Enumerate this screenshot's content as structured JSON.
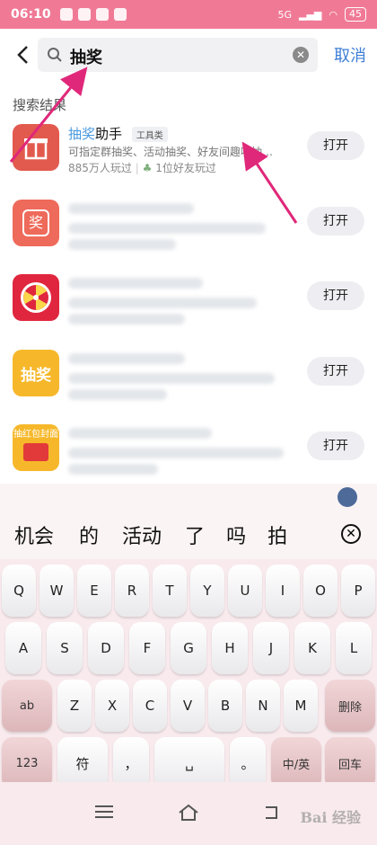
{
  "status_bar": {
    "time": "06:10",
    "network": "5G",
    "battery": "45"
  },
  "search": {
    "query": "抽奖",
    "cancel_label": "取消"
  },
  "results": {
    "section_title": "搜索结果",
    "first": {
      "title_highlight": "抽奖",
      "title_rest": "助手",
      "tag": "工具类",
      "description": "可指定群抽奖、活动抽奖、好友间趣味抽…",
      "players": "885万人玩过",
      "friends": "1位好友玩过"
    },
    "open_label": "打开",
    "icon_labels": [
      "奖",
      "抽奖",
      "抽红包封面"
    ]
  },
  "keyboard": {
    "candidates": [
      "机会",
      "的",
      "活动",
      "了",
      "吗",
      "拍"
    ],
    "row1": [
      "Q",
      "W",
      "E",
      "R",
      "T",
      "Y",
      "U",
      "I",
      "O",
      "P"
    ],
    "row2": [
      "A",
      "S",
      "D",
      "F",
      "G",
      "H",
      "J",
      "K",
      "L"
    ],
    "row3": [
      "Z",
      "X",
      "C",
      "V",
      "B",
      "N",
      "M"
    ],
    "shift_label": "ab",
    "delete_label": "删除",
    "num_label": "123",
    "symbol_label": "符",
    "comma_label": "，",
    "period_label": "。",
    "lang_label": "中/英",
    "enter_label": "回车"
  },
  "watermark": "Bai 经验",
  "colors": {
    "accent": "#f07a96",
    "link": "#3f7fd6",
    "arrow": "#e0287a"
  }
}
